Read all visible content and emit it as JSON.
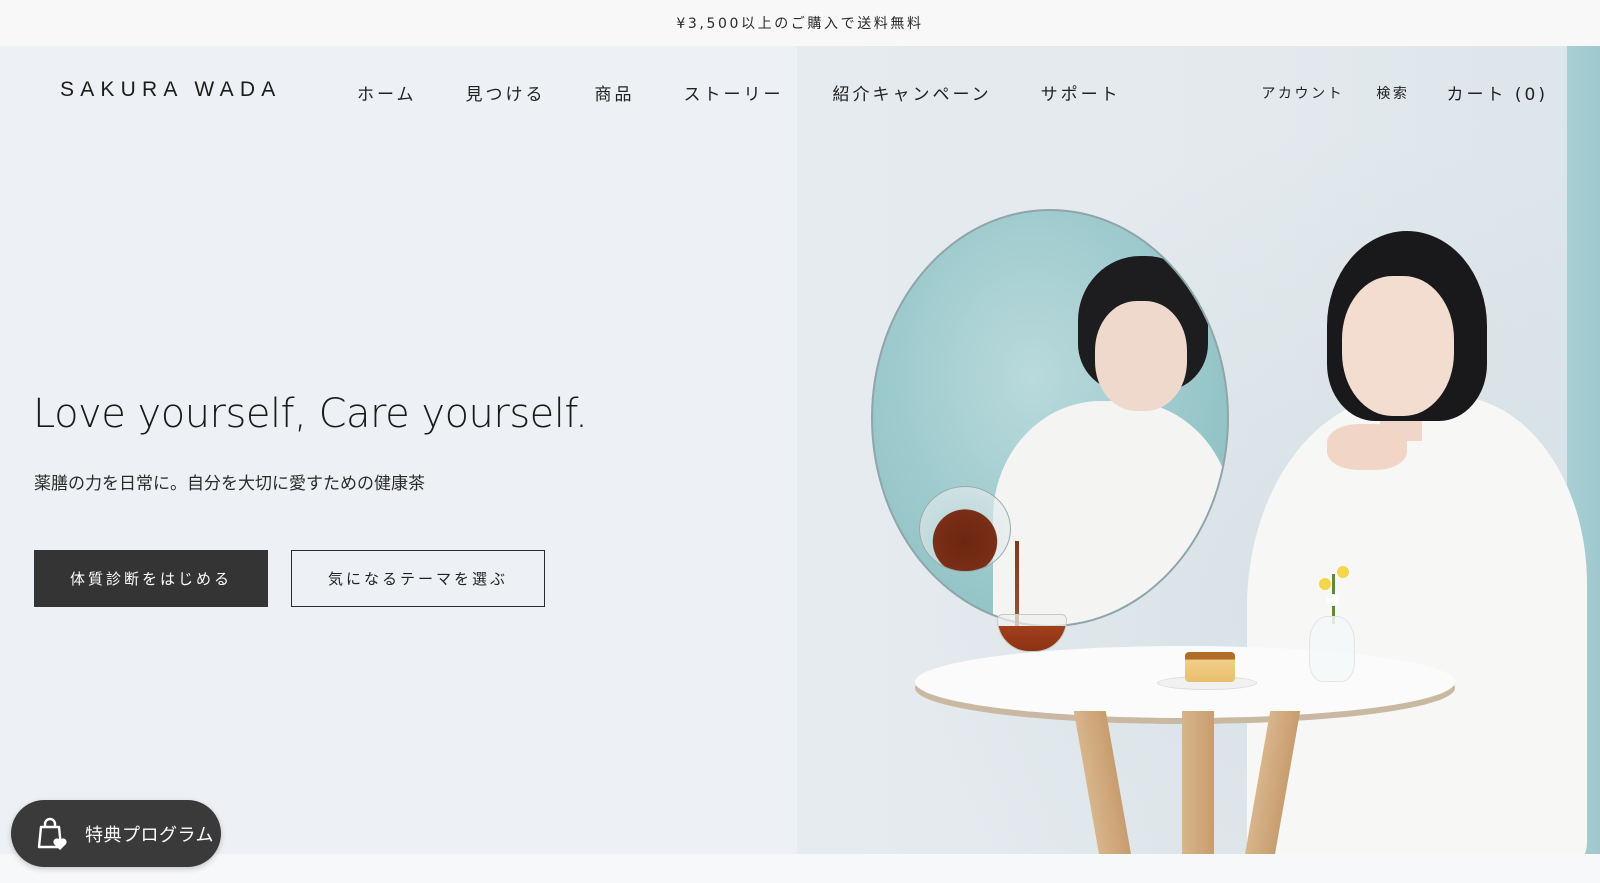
{
  "announcement": {
    "text": "¥3,500以上のご購入で送料無料"
  },
  "header": {
    "logo": "SAKURA WADA",
    "nav": [
      {
        "label": "ホーム"
      },
      {
        "label": "見つける"
      },
      {
        "label": "商品"
      },
      {
        "label": "ストーリー"
      },
      {
        "label": "紹介キャンペーン"
      },
      {
        "label": "サポート"
      }
    ],
    "account_label": "アカウント",
    "search_label": "検索",
    "cart_label": "カート (0)"
  },
  "hero": {
    "headline": "Love yourself, Care yourself.",
    "subcopy": "薬膳の力を日常に。自分を大切に愛すための健康茶",
    "primary_button": "体質診断をはじめる",
    "secondary_button": "気になるテーマを選ぶ"
  },
  "rewards": {
    "label": "特典プログラム",
    "icon": "shopping-bag-heart-icon"
  },
  "colors": {
    "hero_bg": "#edf0f4",
    "primary_button_bg": "#343434",
    "rewards_bg": "#3a3a3a",
    "accent_teal": "#9fc8cd"
  }
}
